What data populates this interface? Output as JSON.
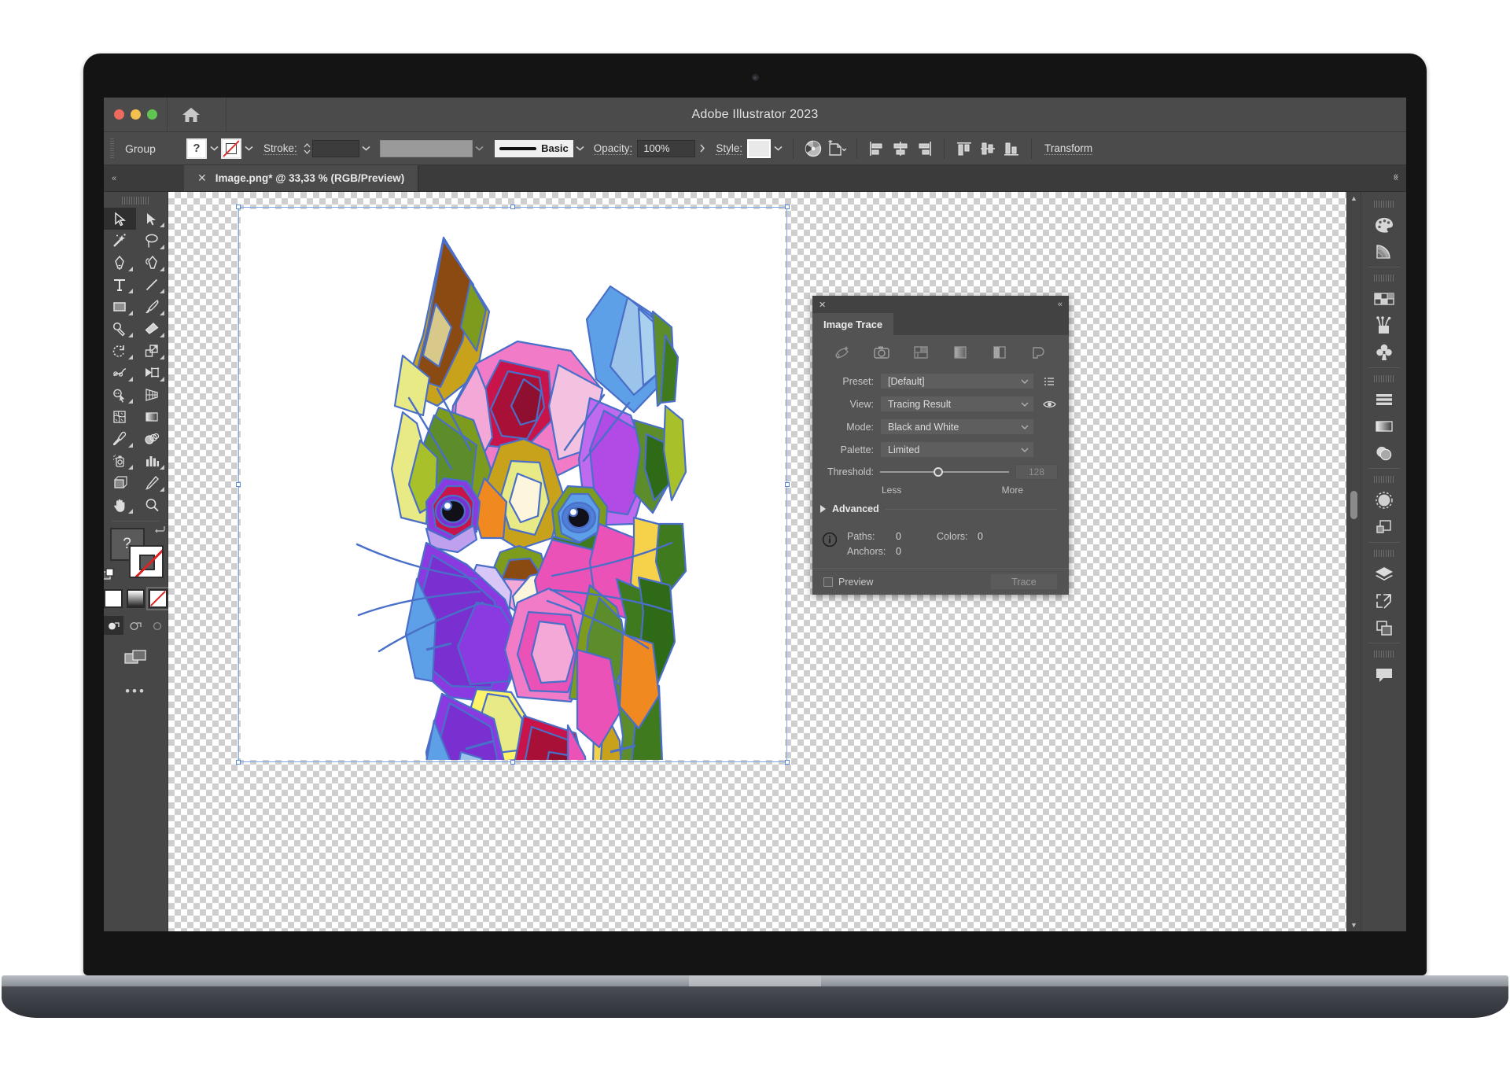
{
  "window": {
    "title": "Adobe Illustrator 2023",
    "traffic_lights": [
      "close",
      "minimize",
      "zoom"
    ],
    "home_icon": "home-icon"
  },
  "control_bar": {
    "selection_label": "Group",
    "fill_swatch_label": "?",
    "stroke_label": "Stroke:",
    "stroke_weight": "",
    "stroke_profile_label": "Basic",
    "opacity_label": "Opacity:",
    "opacity_value": "100%",
    "style_label": "Style:",
    "transform_label": "Transform",
    "icons": [
      "recolor-artwork-icon",
      "document-setup-icon",
      "align-left-icon",
      "align-center-horizontal-icon",
      "align-right-icon",
      "align-top-icon",
      "align-center-vertical-icon",
      "align-bottom-icon"
    ]
  },
  "tab_bar": {
    "tab_label": "Image.png* @ 33,33 % (RGB/Preview)",
    "close_glyph": "✕",
    "collapse_left": "«",
    "collapse_right": "«"
  },
  "tools": {
    "items": [
      {
        "name": "selection-tool",
        "active": true
      },
      {
        "name": "direct-selection-tool",
        "active": false
      },
      {
        "name": "magic-wand-tool",
        "active": false
      },
      {
        "name": "lasso-tool",
        "active": false
      },
      {
        "name": "pen-tool",
        "active": false
      },
      {
        "name": "curvature-tool",
        "active": false
      },
      {
        "name": "type-tool",
        "active": false
      },
      {
        "name": "line-segment-tool",
        "active": false
      },
      {
        "name": "rectangle-tool",
        "active": false
      },
      {
        "name": "paintbrush-tool",
        "active": false
      },
      {
        "name": "shaper-tool",
        "active": false
      },
      {
        "name": "eraser-tool",
        "active": false
      },
      {
        "name": "rotate-tool",
        "active": false
      },
      {
        "name": "scale-tool",
        "active": false
      },
      {
        "name": "width-tool",
        "active": false
      },
      {
        "name": "free-transform-tool",
        "active": false
      },
      {
        "name": "shape-builder-tool",
        "active": false
      },
      {
        "name": "perspective-grid-tool",
        "active": false
      },
      {
        "name": "mesh-tool",
        "active": false
      },
      {
        "name": "gradient-tool",
        "active": false
      },
      {
        "name": "eyedropper-tool",
        "active": false
      },
      {
        "name": "blend-tool",
        "active": false
      },
      {
        "name": "symbol-sprayer-tool",
        "active": false
      },
      {
        "name": "column-graph-tool",
        "active": false
      },
      {
        "name": "artboard-tool",
        "active": false
      },
      {
        "name": "slice-tool",
        "active": false
      },
      {
        "name": "hand-tool",
        "active": false
      },
      {
        "name": "zoom-tool",
        "active": false
      }
    ],
    "fill_label": "?",
    "paint_modes": [
      "color-swatch-mode",
      "gradient-mode",
      "none-mode"
    ],
    "draw_modes": [
      "draw-normal",
      "draw-behind",
      "draw-inside"
    ],
    "screen_mode": "change-screen-mode",
    "more_tools": "•••"
  },
  "image_trace": {
    "panel_title": "Image Trace",
    "close_glyph": "✕",
    "collapse_glyph": "«",
    "preset_icons": [
      "auto-color-icon",
      "high-color-icon",
      "low-color-icon",
      "grayscale-icon",
      "black-white-icon",
      "outline-icon"
    ],
    "rows": [
      {
        "label": "Preset:",
        "value": "[Default]",
        "side_icon": "preset-menu-icon"
      },
      {
        "label": "View:",
        "value": "Tracing Result",
        "side_icon": "eye-icon"
      },
      {
        "label": "Mode:",
        "value": "Black and White",
        "side_icon": ""
      },
      {
        "label": "Palette:",
        "value": "Limited",
        "side_icon": ""
      }
    ],
    "threshold": {
      "label": "Threshold:",
      "value": "128",
      "less_label": "Less",
      "more_label": "More",
      "percent": 45
    },
    "advanced_label": "Advanced",
    "info": {
      "paths_label": "Paths:",
      "paths_value": "0",
      "colors_label": "Colors:",
      "colors_value": "0",
      "anchors_label": "Anchors:",
      "anchors_value": "0"
    },
    "preview_label": "Preview",
    "trace_label": "Trace"
  },
  "right_dock": {
    "groups": [
      [
        "color-palette-icon",
        "color-guide-icon"
      ],
      [
        "swatches-icon",
        "brushes-icon",
        "symbols-icon"
      ],
      [
        "align-panel-icon",
        "gradient-panel-icon",
        "transparency-icon"
      ],
      [
        "appearance-icon",
        "graphic-styles-icon"
      ],
      [
        "layers-icon",
        "artboards-panel-icon",
        "asset-export-icon"
      ],
      [
        "comments-icon"
      ]
    ],
    "collapse_glyph": "«"
  },
  "artwork": {
    "name": "colorful-geometric-cat",
    "palette": [
      "#8a4a12",
      "#c9a21c",
      "#d8c98a",
      "#e8ea86",
      "#7d9b1c",
      "#3f7a1e",
      "#2f6b16",
      "#5d8c2a",
      "#a8c02a",
      "#5ea0e8",
      "#9cc3ea",
      "#a9d0ef",
      "#4f7fd6",
      "#8a3ae0",
      "#7a2fd0",
      "#b24ae6",
      "#c06af0",
      "#ea52b8",
      "#f27bc8",
      "#f4a8d8",
      "#f2c2e0",
      "#c8144a",
      "#a81038",
      "#8f0f30",
      "#f08a20",
      "#f5d24a",
      "#fff36a",
      "#efe9c0",
      "#fdf6dd",
      "#bfa0ee",
      "#d8c6f6"
    ],
    "outline_color": "#4a6fc8",
    "background": "#ffffff"
  },
  "scrollbar": {
    "up_glyph": "▲",
    "down_glyph": "▼"
  }
}
